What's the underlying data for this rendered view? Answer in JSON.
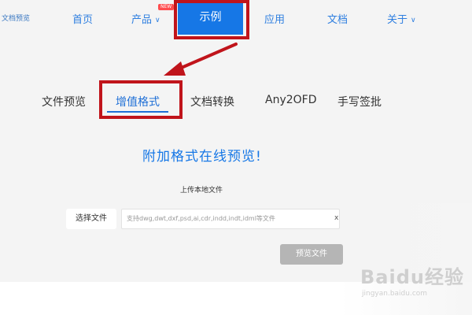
{
  "logo": {
    "text": "文档预览"
  },
  "nav": {
    "home": "首页",
    "products": "产品",
    "products_badge": "NEW",
    "examples": "示例",
    "apps": "应用",
    "docs": "文档",
    "about": "关于"
  },
  "tabs": [
    {
      "label": "文件预览"
    },
    {
      "label": "增值格式"
    },
    {
      "label": "文档转换"
    },
    {
      "label": "Any2OFD"
    },
    {
      "label": "手写签批"
    }
  ],
  "active_tab": "增值格式",
  "main": {
    "heading": "附加格式在线预览!",
    "upload_label": "上传本地文件",
    "choose_button": "选择文件",
    "file_placeholder": "支持dwg,dwt,dxf,psd,ai,cdr,indd,indt,idml等文件",
    "clear": "x",
    "preview_button": "预览文件"
  },
  "watermark": {
    "brand": "Baidu经验",
    "url": "jingyan.baidu.com"
  },
  "colors": {
    "accent": "#1677e6",
    "highlight": "#c0141b"
  }
}
